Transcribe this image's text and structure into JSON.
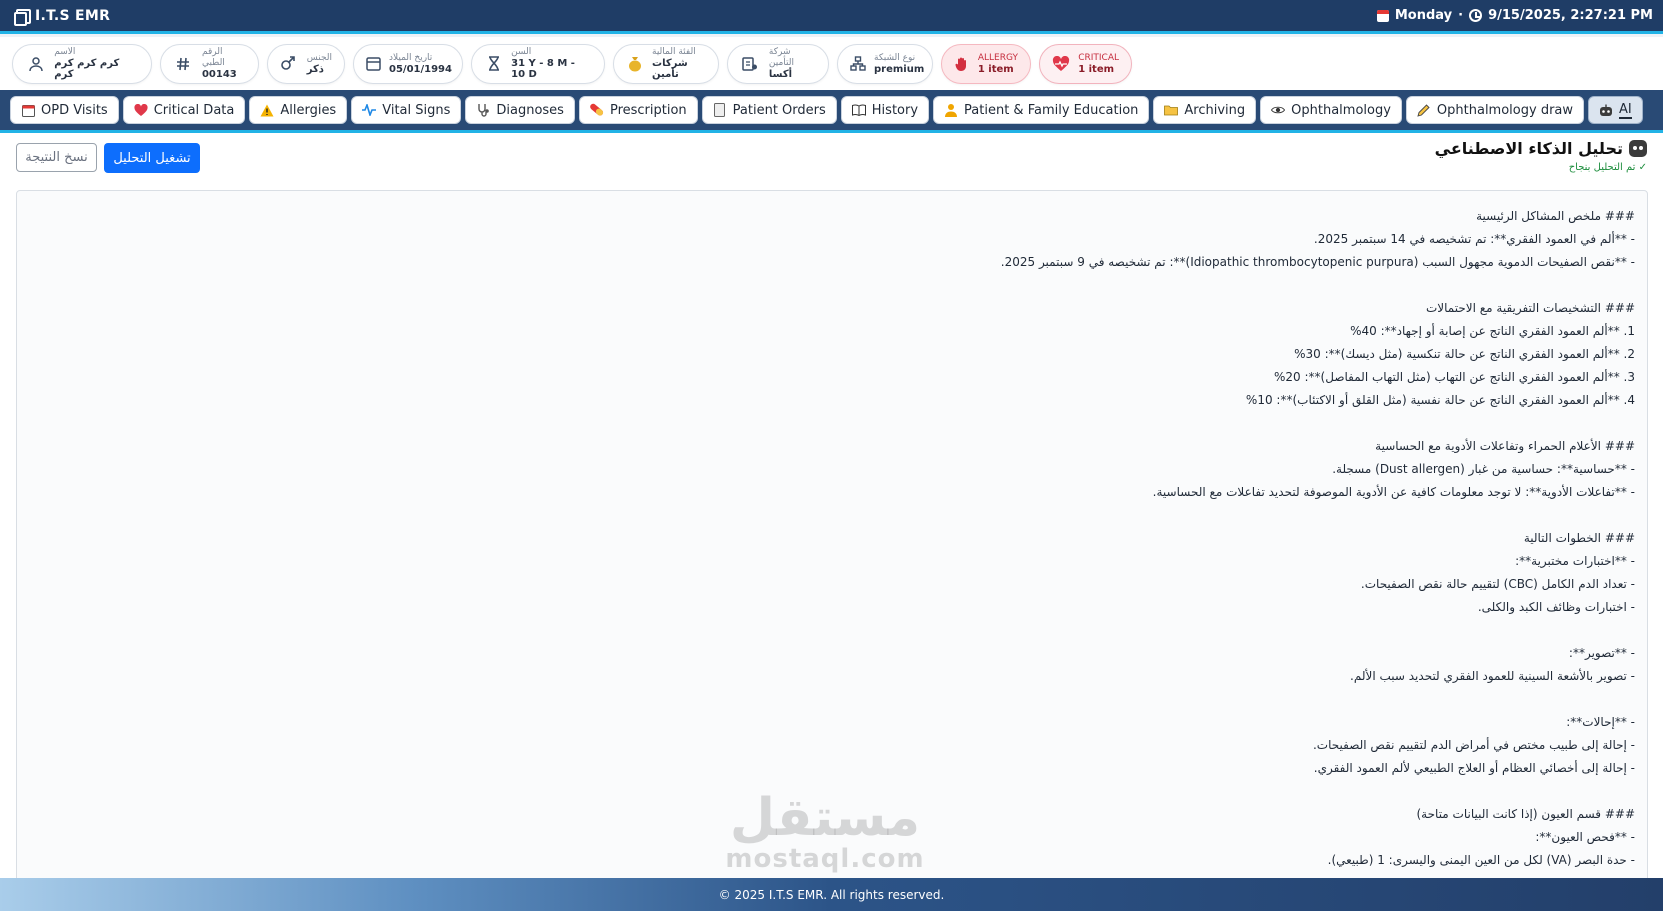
{
  "app": {
    "brand": "I.T.S EMR",
    "day": "Monday",
    "separator": "·",
    "datetime": "9/15/2025, 2:27:21 PM"
  },
  "patient": [
    {
      "label": "الاسم",
      "value": "كرم كرم كرم كرم",
      "icon": "person-icon"
    },
    {
      "label": "الرقم الطبي",
      "value": "00143",
      "icon": "hash-icon"
    },
    {
      "label": "الجنس",
      "value": "ذكر",
      "icon": "gender-icon"
    },
    {
      "label": "تاريخ الميلاد",
      "value": "05/01/1994",
      "icon": "calendar-icon"
    },
    {
      "label": "السن",
      "value": "31 Y - 8 M - 10 D",
      "icon": "hourglass-icon"
    },
    {
      "label": "الفئة المالية",
      "value": "شركات تأمين",
      "icon": "money-bag-icon"
    },
    {
      "label": "شركة التأمين",
      "value": "أكسا",
      "icon": "insurance-icon"
    },
    {
      "label": "نوع الشبكة",
      "value": "premium",
      "icon": "network-icon"
    },
    {
      "label": "ALLERGY",
      "value": "1 item",
      "icon": "hand-icon"
    },
    {
      "label": "CRITICAL",
      "value": "1 item",
      "icon": "heart-pulse-icon"
    }
  ],
  "tabs": [
    {
      "label": "OPD Visits",
      "icon": "calendar-icon"
    },
    {
      "label": "Critical Data",
      "icon": "heart-icon"
    },
    {
      "label": "Allergies",
      "icon": "warning-icon"
    },
    {
      "label": "Vital Signs",
      "icon": "pulse-icon"
    },
    {
      "label": "Diagnoses",
      "icon": "stethoscope-icon"
    },
    {
      "label": "Prescription",
      "icon": "pill-icon"
    },
    {
      "label": "Patient Orders",
      "icon": "document-icon"
    },
    {
      "label": "History",
      "icon": "book-icon"
    },
    {
      "label": "Patient & Family Education",
      "icon": "family-icon"
    },
    {
      "label": "Archiving",
      "icon": "folder-icon"
    },
    {
      "label": "Ophthalmology",
      "icon": "eye-icon"
    },
    {
      "label": "Ophthalmology draw",
      "icon": "pencil-icon"
    },
    {
      "label": "AI",
      "icon": "robot-icon",
      "active": true
    }
  ],
  "ai": {
    "title": "تحليل الذكاء الاصطناعي",
    "status": "✓ تم التحليل بنجاح",
    "copy_label": "نسخ النتيجة",
    "run_label": "تشغيل التحليل",
    "result_lines": [
      "### ملخص المشاكل الرئيسية",
      "- **ألم في العمود الفقري**: تم تشخيصه في 14 سبتمبر 2025.",
      "- **نقص الصفيحات الدموية مجهول السبب (Idiopathic thrombocytopenic purpura)**: تم تشخيصه في 9 سبتمبر 2025.",
      "",
      "### التشخيصات التفريقية مع الاحتمالات",
      "1. **ألم العمود الفقري الناتج عن إصابة أو إجهاد**: 40%",
      "2. **ألم العمود الفقري الناتج عن حالة تنكسية (مثل ديسك)**: 30%",
      "3. **ألم العمود الفقري الناتج عن التهاب (مثل التهاب المفاصل)**: 20%",
      "4. **ألم العمود الفقري الناتج عن حالة نفسية (مثل القلق أو الاكتئاب)**: 10%",
      "",
      "### الأعلام الحمراء وتفاعلات الأدوية مع الحساسية",
      "- **حساسية**: حساسية من غبار (Dust allergen) مسجلة.",
      "- **تفاعلات الأدوية**: لا توجد معلومات كافية عن الأدوية الموصوفة لتحديد تفاعلات مع الحساسية.",
      "",
      "### الخطوات التالية",
      "- **اختبارات مختبرية**:",
      "  - تعداد الدم الكامل (CBC) لتقييم حالة نقص الصفيحات.",
      "  - اختبارات وظائف الكبد والكلى.",
      "",
      "- **تصوير**:",
      "  - تصوير بالأشعة السينية للعمود الفقري لتحديد سبب الألم.",
      "",
      "- **إحالات**:",
      "  - إحالة إلى طبيب مختص في أمراض الدم لتقييم نقص الصفيحات.",
      "  - إحالة إلى أخصائي العظام أو العلاج الطبيعي لألم العمود الفقري.",
      "",
      "### قسم العيون (إذا كانت البيانات متاحة)",
      "- **فحص العيون**:",
      "  - حدة البصر (VA) لكل من العين اليمنى واليسرى: 1 (طبيعي)."
    ]
  },
  "watermark": {
    "arabic": "مستقل",
    "latin": "mostaql.com"
  },
  "footer": {
    "text": "© 2025 I.T.S EMR. All rights reserved."
  },
  "colors": {
    "header": "#1f3d66",
    "accent": "#22b3e6",
    "primary_button": "#0d6efd",
    "success": "#1e8e3e",
    "danger": "#c62f3f"
  }
}
